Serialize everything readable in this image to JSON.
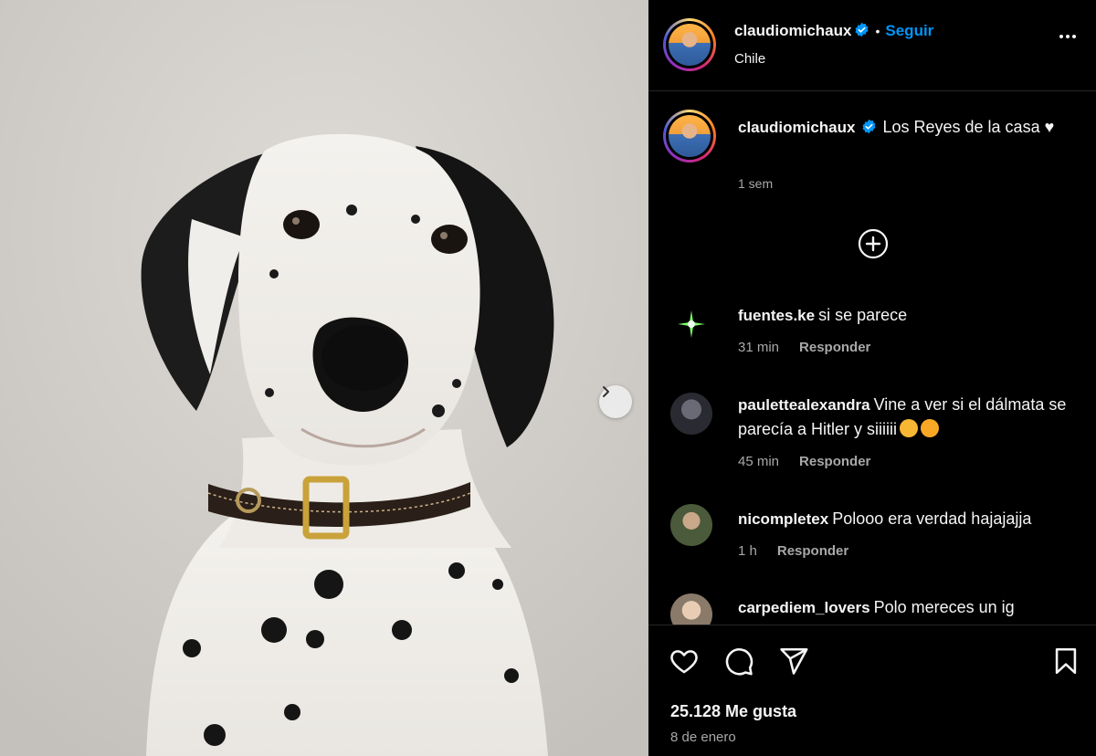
{
  "post": {
    "author": "claudiomichaux",
    "follow_label": "Seguir",
    "dot": "•",
    "location": "Chile",
    "caption": "Los Reyes de la casa ♥",
    "caption_time": "1 sem",
    "likes": "25.128 Me gusta",
    "date": "8 de enero"
  },
  "comments": [
    {
      "user": "fuentes.ke",
      "text": "si se parece",
      "time": "31 min",
      "reply": "Responder",
      "avatar_color": "#0a0a0a"
    },
    {
      "user": "paulettealexandra",
      "text": "Vine a ver si el dálmata se parecía a Hitler y siiiiii",
      "time": "45 min",
      "reply": "Responder",
      "avatar_color": "#3a3a44"
    },
    {
      "user": "nicompletex",
      "text": "Polooo era verdad hajajajja",
      "time": "1 h",
      "reply": "Responder",
      "avatar_color": "#4a5a3a"
    },
    {
      "user": "carpediem_lovers",
      "text": "Polo mereces un ig",
      "time": "",
      "reply": "",
      "avatar_color": "#8a7a6a"
    }
  ],
  "icons": {
    "heart": "heart-icon",
    "comment": "comment-icon",
    "share": "share-icon",
    "save": "bookmark-icon",
    "next": "chevron-right-icon",
    "more": "more-options-icon",
    "verified": "verified-badge-icon",
    "add": "add-circle-icon"
  },
  "colors": {
    "accent": "#0095f6",
    "verified": "#0095f6",
    "background": "#000000",
    "muted_text": "#a8a8a8"
  }
}
